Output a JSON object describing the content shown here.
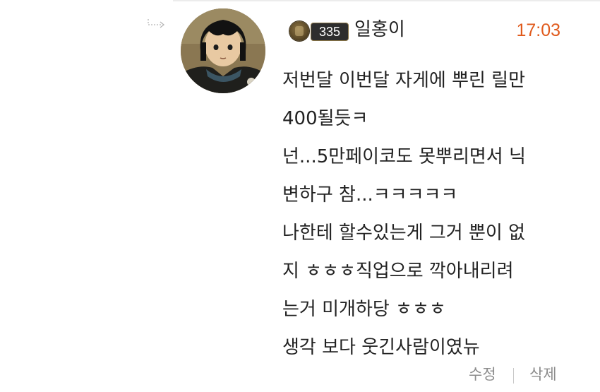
{
  "comment": {
    "author": {
      "level": "335",
      "name": "일홍이"
    },
    "time": "17:03",
    "lines": [
      "저번달 이번달 자게에 뿌린 릴만",
      "400될듯ㅋ",
      "넌...5만페이코도 못뿌리면서 닉",
      "변하구 참...ㅋㅋㅋㅋㅋ",
      "나한테 할수있는게 그거 뿐이 없",
      "지 ㅎㅎㅎ직업으로 깍아내리려",
      "는거 미개하당 ㅎㅎㅎ",
      "생각 보다 웃긴사람이였뉴"
    ],
    "actions": {
      "edit_label": "수정",
      "delete_label": "삭제"
    }
  },
  "icons": {
    "reply": "reply-arrow-icon",
    "badge": "level-badge-emblem-icon",
    "avatar": "user-avatar-image"
  },
  "colors": {
    "time": "#e05a1c",
    "text": "#222222",
    "actions": "#8c8c8c",
    "badge_bg": "#2e2e2e"
  }
}
